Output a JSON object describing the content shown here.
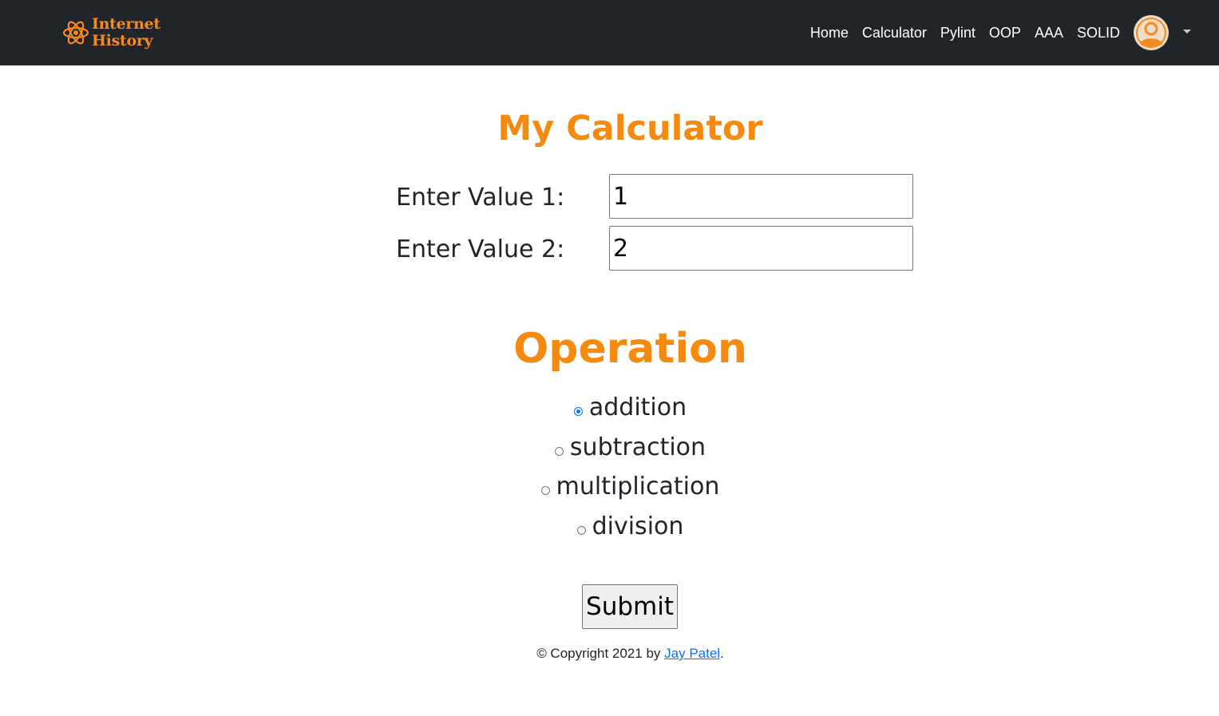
{
  "navbar": {
    "logo": {
      "line1": "Internet",
      "line2": "History"
    },
    "links": [
      "Home",
      "Calculator",
      "Pylint",
      "OOP",
      "AAA",
      "SOLID"
    ]
  },
  "main": {
    "title": "My Calculator",
    "value1_label": "Enter Value 1:",
    "value1": "1",
    "value2_label": "Enter Value 2:",
    "value2": "2",
    "operation_title": "Operation",
    "operations": [
      "addition",
      "subtraction",
      "multiplication",
      "division"
    ],
    "selected_operation": "addition",
    "submit_label": "Submit"
  },
  "footer": {
    "prefix": "© Copyright 2021 by ",
    "author": "Jay Patel",
    "suffix": "."
  },
  "colors": {
    "navbar_bg": "#212529",
    "accent": "#f58a0e",
    "link": "#0d6efd"
  }
}
